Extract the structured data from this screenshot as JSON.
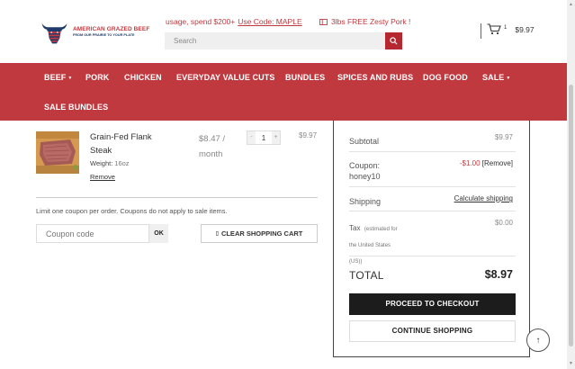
{
  "brand": {
    "name": "AMERICAN GRAZED BEEF",
    "tagline": "FROM OUR PRAIRIE TO YOUR PLATE"
  },
  "promos": {
    "offer_text": "usage, spend $200+",
    "offer_code": "Use Code: MAPLE",
    "gift_text": "3lbs FREE Zesty Pork !"
  },
  "search": {
    "placeholder": "Search"
  },
  "cart_header": {
    "count": "1",
    "total": "$9.97"
  },
  "nav": {
    "items": [
      {
        "label": "BEEF",
        "has_caret": true
      },
      {
        "label": "PORK"
      },
      {
        "label": "CHICKEN"
      },
      {
        "label": "EVERYDAY VALUE CUTS"
      },
      {
        "label": "BUNDLES"
      },
      {
        "label": "SPICES AND RUBS"
      },
      {
        "label": "DOG FOOD"
      },
      {
        "label": "SALE",
        "has_caret": true
      },
      {
        "label": "SALE BUNDLES"
      }
    ]
  },
  "cart_item": {
    "name": "Grain-Fed Flank Steak",
    "weight_label": "Weight:",
    "weight_value": "16oz",
    "remove": "Remove",
    "price": "$8.47 / month",
    "quantity": "1",
    "subtotal": "$9.97"
  },
  "coupon": {
    "note": "Limit one coupon per order. Coupons do not apply to sale items.",
    "placeholder": "Coupon code",
    "apply_label": "OK",
    "clear_cart_label": "CLEAR SHOPPING CART"
  },
  "totals": {
    "subtotal_label": "Subtotal",
    "subtotal_value": "$9.97",
    "coupon_label": "Coupon: honey10",
    "coupon_value": "-$1.00",
    "coupon_remove": "[Remove]",
    "shipping_label": "Shipping",
    "shipping_action": "Calculate shipping",
    "tax_label": "Tax",
    "tax_note": "(estimated for the United States (US))",
    "tax_value": "$0.00",
    "total_label": "TOTAL",
    "total_value": "$8.97",
    "checkout_label": "PROCEED TO CHECKOUT",
    "continue_label": "CONTINUE SHOPPING"
  },
  "colors": {
    "brand_red": "#c0393f",
    "dark_button": "#1c1c1c"
  },
  "icons": [
    "bull-logo-icon",
    "gift-icon",
    "search-icon",
    "cart-icon",
    "chevron-down-icon",
    "trash-icon",
    "arrow-up-icon"
  ]
}
